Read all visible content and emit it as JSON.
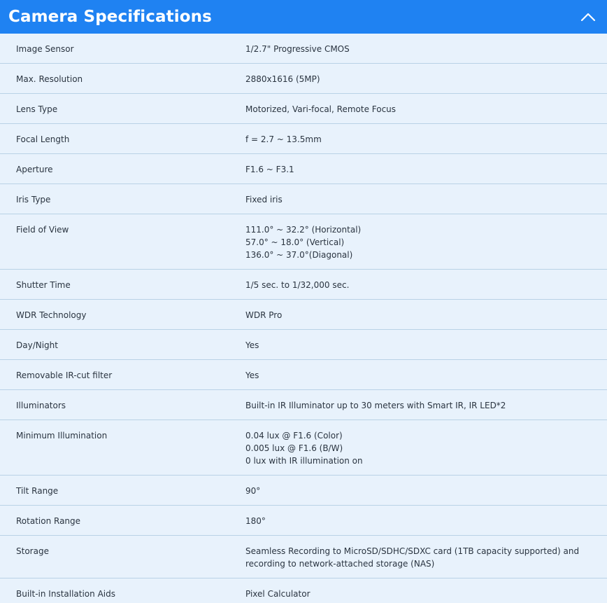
{
  "header": {
    "title": "Camera Specifications",
    "collapse_icon": "chevron-up-icon",
    "background": "#1f82f2"
  },
  "specs": [
    {
      "label": "Image Sensor",
      "values": [
        "1/2.7\" Progressive CMOS"
      ]
    },
    {
      "label": "Max. Resolution",
      "values": [
        "2880x1616 (5MP)"
      ]
    },
    {
      "label": "Lens Type",
      "values": [
        "Motorized, Vari-focal, Remote Focus"
      ]
    },
    {
      "label": "Focal Length",
      "values": [
        "f = 2.7 ~ 13.5mm"
      ]
    },
    {
      "label": "Aperture",
      "values": [
        "F1.6 ~ F3.1"
      ]
    },
    {
      "label": "Iris Type",
      "values": [
        "Fixed iris"
      ]
    },
    {
      "label": "Field of View",
      "values": [
        "111.0° ~ 32.2° (Horizontal)",
        "57.0° ~ 18.0° (Vertical)",
        "136.0° ~ 37.0°(Diagonal)"
      ]
    },
    {
      "label": "Shutter Time",
      "values": [
        "1/5 sec. to 1/32,000 sec."
      ]
    },
    {
      "label": "WDR Technology",
      "values": [
        "WDR Pro"
      ]
    },
    {
      "label": "Day/Night",
      "values": [
        "Yes"
      ]
    },
    {
      "label": "Removable IR-cut filter",
      "values": [
        "Yes"
      ]
    },
    {
      "label": "Illuminators",
      "values": [
        "Built-in IR Illuminator up to 30 meters with Smart IR, IR LED*2"
      ]
    },
    {
      "label": "Minimum Illumination",
      "values": [
        "0.04 lux @ F1.6 (Color)",
        "0.005 lux @ F1.6 (B/W)",
        "0 lux with IR illumination on"
      ]
    },
    {
      "label": "Tilt Range",
      "values": [
        "90°"
      ]
    },
    {
      "label": "Rotation Range",
      "values": [
        "180°"
      ]
    },
    {
      "label": "Storage",
      "values": [
        "Seamless Recording to MicroSD/SDHC/SDXC card (1TB capacity supported) and",
        "recording to network-attached storage (NAS)"
      ]
    },
    {
      "label": "Built-in Installation Aids",
      "values": [
        "Pixel Calculator"
      ]
    }
  ]
}
